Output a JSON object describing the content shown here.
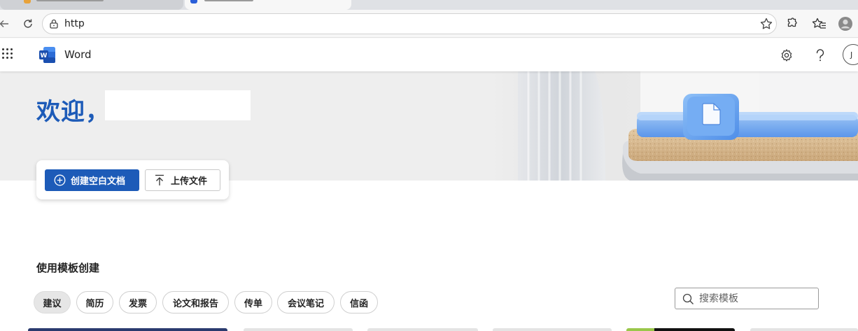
{
  "browser": {
    "url": "http",
    "icons": [
      "back-arrow-icon",
      "reload-icon",
      "lock-icon",
      "star-icon",
      "extensions-icon",
      "favorites-icon",
      "profile-icon"
    ]
  },
  "app": {
    "name": "Word",
    "icons": [
      "app-launcher-icon",
      "word-logo-icon",
      "settings-icon",
      "help-icon"
    ],
    "avatar_initial": "J"
  },
  "hero": {
    "welcome": "欢迎，",
    "create_blank_label": "创建空白文档",
    "upload_label": "上传文件",
    "accent_color": "#1d5bb8"
  },
  "templates": {
    "section_title": "使用模板创建",
    "categories": [
      {
        "label": "建议",
        "active": true
      },
      {
        "label": "简历",
        "active": false
      },
      {
        "label": "发票",
        "active": false
      },
      {
        "label": "论文和报告",
        "active": false
      },
      {
        "label": "传单",
        "active": false
      },
      {
        "label": "会议笔记",
        "active": false
      },
      {
        "label": "信函",
        "active": false
      }
    ],
    "search_placeholder": "搜索模板"
  }
}
